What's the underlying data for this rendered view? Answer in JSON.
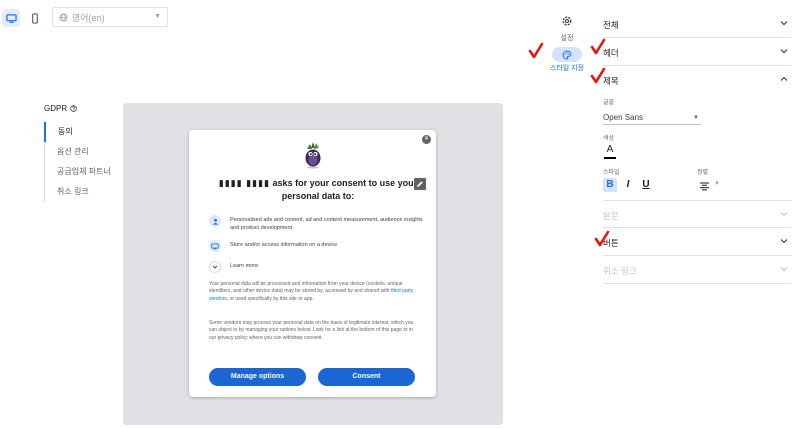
{
  "toolbar": {
    "desktop_icon": "desktop-icon",
    "mobile_icon": "mobile-icon",
    "language_value": "영어(en)"
  },
  "side_tabs": {
    "settings_label": "설정",
    "style_label": "스타일 지정"
  },
  "gdpr_nav": {
    "title": "GDPR",
    "items": [
      {
        "label": "동의"
      },
      {
        "label": "옵션 관리"
      },
      {
        "label": "공급업체 파트너"
      },
      {
        "label": "취소 링크"
      }
    ]
  },
  "modal": {
    "headline_brand": "▮▮▮▮ ▮▮▮▮",
    "headline": "asks for your consent to use your personal data to:",
    "purposes": [
      {
        "text": "Personalised ads and content, ad and content measurement, audience insights and product development",
        "icon": "person-icon"
      },
      {
        "text": "Store and/or access information on a device",
        "icon": "device-icon"
      }
    ],
    "learn_more": "Learn more",
    "body_1a": "Your personal data will be processed and information from your device (cookies, unique identifiers, and other device data) may be stored by, accessed by and shared with ",
    "body_1_link": "third party vendors",
    "body_1b": ", or used specifically by this site or app.",
    "body_2": "Some vendors may process your personal data on the basis of legitimate interest, which you can object to by managing your options below. Look for a link at the bottom of this page or in our privacy policy where you can withdraw consent.",
    "manage_label": "Manage options",
    "consent_label": "Consent"
  },
  "panel": {
    "sections": [
      {
        "label": "전체"
      },
      {
        "label": "헤더"
      },
      {
        "label": "제목"
      },
      {
        "label": "본문"
      },
      {
        "label": "버튼"
      },
      {
        "label": "취소 링크"
      }
    ],
    "font_label": "글꼴",
    "font_value": "Open Sans",
    "color_label": "색상",
    "style_label": "스타일",
    "align_label": "정렬"
  },
  "colors": {
    "accent": "#1a73e8",
    "button": "#1a66d2",
    "check_mark": "#e8150f",
    "preview_bg": "#dfe1e5"
  }
}
